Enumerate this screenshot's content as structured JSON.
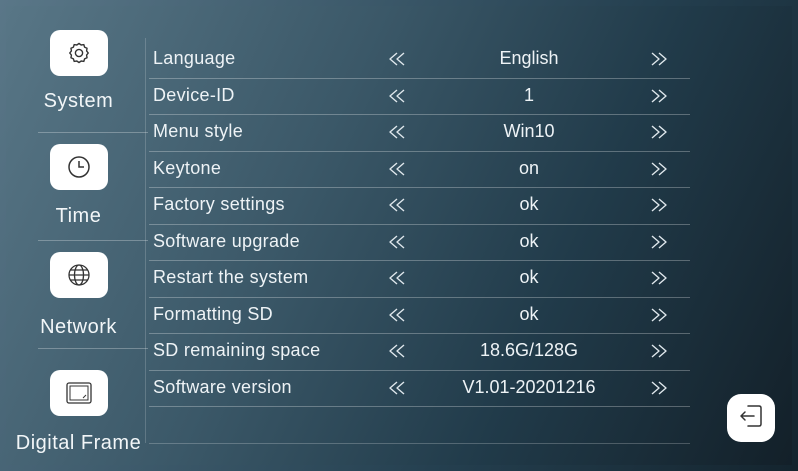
{
  "sidebar": {
    "items": [
      {
        "label": "System",
        "icon": "settings-gear-icon"
      },
      {
        "label": "Time",
        "icon": "clock-icon"
      },
      {
        "label": "Network",
        "icon": "globe-icon"
      },
      {
        "label": "Digital Frame",
        "icon": "photo-frame-icon"
      }
    ]
  },
  "settings": {
    "rows": [
      {
        "label": "Language",
        "value": "English"
      },
      {
        "label": "Device-ID",
        "value": "1"
      },
      {
        "label": "Menu style",
        "value": "Win10"
      },
      {
        "label": "Keytone",
        "value": "on"
      },
      {
        "label": "Factory settings",
        "value": "ok"
      },
      {
        "label": "Software upgrade",
        "value": "ok"
      },
      {
        "label": "Restart the system",
        "value": "ok"
      },
      {
        "label": "Formatting SD",
        "value": "ok"
      },
      {
        "label": "SD remaining space",
        "value": "18.6G/128G"
      },
      {
        "label": "Software version",
        "value": "V1.01-20201216"
      }
    ],
    "prev_icon": "double-chevron-left-icon",
    "next_icon": "double-chevron-right-icon"
  },
  "back_button": {
    "icon": "exit-arrow-icon"
  }
}
